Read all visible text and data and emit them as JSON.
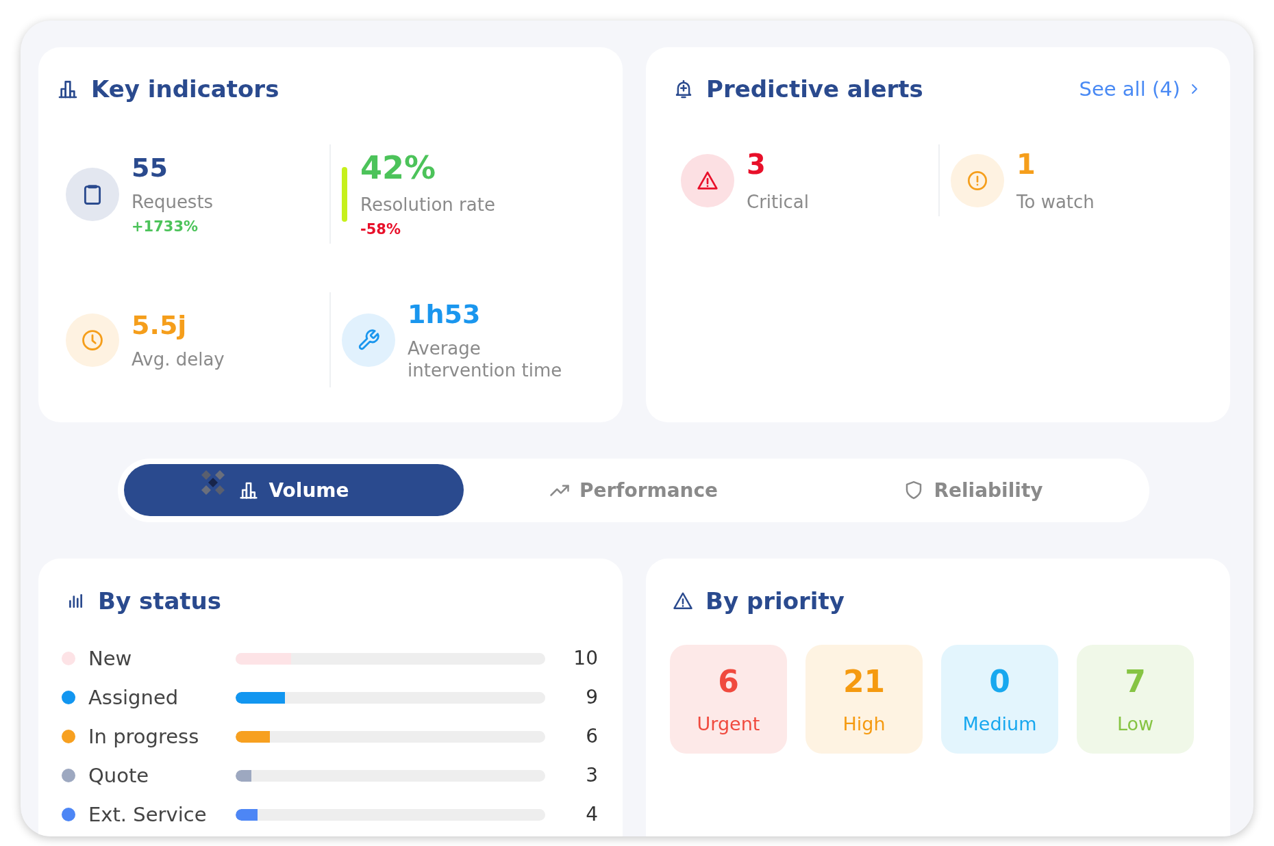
{
  "key_indicators": {
    "title": "Key indicators",
    "items": [
      {
        "kind": "badge",
        "value": "55",
        "label": "Requests",
        "change": "+1733%",
        "positive": true,
        "color": "#2a4a8e"
      },
      {
        "kind": "accent",
        "value": "42%",
        "label": "Resolution rate",
        "change": "-58%",
        "positive": false,
        "color": "#4cc35a"
      },
      {
        "kind": "badge",
        "value": "5.5j",
        "label": "Avg. delay",
        "color": "#f59e1b"
      },
      {
        "kind": "badge",
        "value": "1h53",
        "label": "Average intervention time",
        "color": "#1a96ee"
      }
    ]
  },
  "predictive_alerts": {
    "title": "Predictive alerts",
    "see_all": "See all (4)",
    "items": [
      {
        "count": "3",
        "label": "Critical",
        "color": "#e8102a"
      },
      {
        "count": "1",
        "label": "To watch",
        "color": "#f59e1b"
      }
    ]
  },
  "tabs": [
    {
      "label": "Volume",
      "selected": true
    },
    {
      "label": "Performance",
      "selected": false
    },
    {
      "label": "Reliability",
      "selected": false
    }
  ],
  "by_status": {
    "title": "By status",
    "rows": [
      {
        "label": "New",
        "count": "10",
        "level": 0.18,
        "color": "#fde3e6"
      },
      {
        "label": "Assigned",
        "count": "9",
        "level": 0.16,
        "color": "#1296f0"
      },
      {
        "label": "In progress",
        "count": "6",
        "level": 0.11,
        "color": "#f7a020"
      },
      {
        "label": "Quote",
        "count": "3",
        "level": 0.05,
        "color": "#9da8c0"
      },
      {
        "label": "Ext. Service",
        "count": "4",
        "level": 0.07,
        "color": "#4d86f5"
      }
    ]
  },
  "by_priority": {
    "title": "By priority",
    "items": [
      {
        "label": "Urgent",
        "count": "6",
        "color": "#f04a3e"
      },
      {
        "label": "High",
        "count": "21",
        "color": "#f59a10"
      },
      {
        "label": "Medium",
        "count": "0",
        "color": "#18a8ef"
      },
      {
        "label": "Low",
        "count": "7",
        "color": "#86c443"
      }
    ]
  }
}
